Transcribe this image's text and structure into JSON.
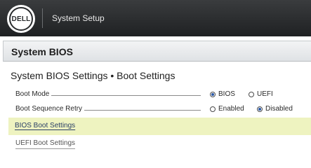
{
  "header": {
    "logo_text": "DELL",
    "app_title": "System Setup"
  },
  "section": {
    "title": "System BIOS"
  },
  "page": {
    "title": "System BIOS Settings • Boot Settings"
  },
  "settings": [
    {
      "label": "Boot Mode",
      "options": [
        {
          "label": "BIOS",
          "checked": true
        },
        {
          "label": "UEFI",
          "checked": false
        }
      ]
    },
    {
      "label": "Boot Sequence Retry",
      "options": [
        {
          "label": "Enabled",
          "checked": false
        },
        {
          "label": "Disabled",
          "checked": true
        }
      ]
    }
  ],
  "links": {
    "bios_boot_settings": "BIOS Boot Settings",
    "uefi_boot_settings": "UEFI Boot Settings"
  },
  "colors": {
    "topbar": "#2b2d2f",
    "highlight": "#eef3c0",
    "radio_checked": "#2b58a6"
  }
}
